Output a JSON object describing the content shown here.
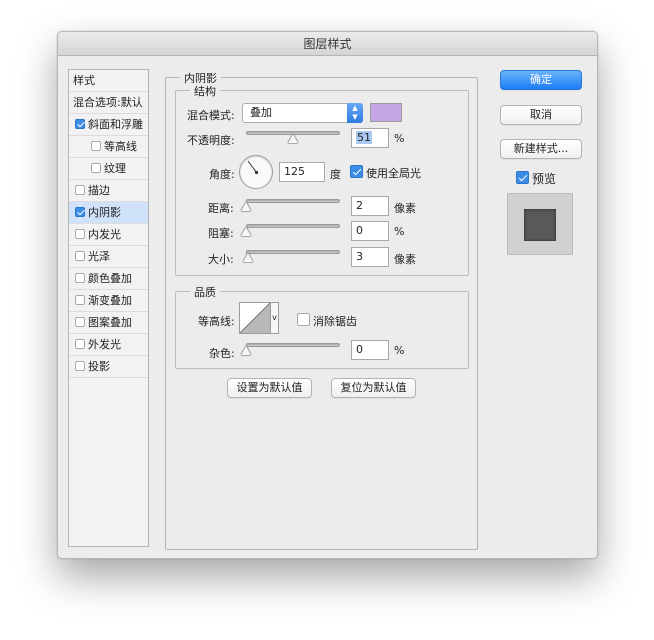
{
  "window": {
    "title": "图层样式"
  },
  "sidebar": {
    "header": "样式",
    "blend_options": "混合选项:默认",
    "items": [
      {
        "label": "斜面和浮雕",
        "checked": true
      },
      {
        "label": "等高线",
        "checked": false
      },
      {
        "label": "纹理",
        "checked": false
      },
      {
        "label": "描边",
        "checked": false
      },
      {
        "label": "内阴影",
        "checked": true,
        "selected": true
      },
      {
        "label": "内发光",
        "checked": false
      },
      {
        "label": "光泽",
        "checked": false
      },
      {
        "label": "颜色叠加",
        "checked": false
      },
      {
        "label": "渐变叠加",
        "checked": false
      },
      {
        "label": "图案叠加",
        "checked": false
      },
      {
        "label": "外发光",
        "checked": false
      },
      {
        "label": "投影",
        "checked": false
      }
    ]
  },
  "panel": {
    "title": "内阴影",
    "structure": {
      "title": "结构",
      "blend_mode_label": "混合模式:",
      "blend_mode_value": "叠加",
      "color": "#c4a6e6",
      "opacity_label": "不透明度:",
      "opacity_value": "51",
      "opacity_unit": "%",
      "angle_label": "角度:",
      "angle_value": "125",
      "angle_unit": "度",
      "global_light_label": "使用全局光",
      "global_light_checked": true,
      "distance_label": "距离:",
      "distance_value": "2",
      "distance_unit": "像素",
      "choke_label": "阻塞:",
      "choke_value": "0",
      "choke_unit": "%",
      "size_label": "大小:",
      "size_value": "3",
      "size_unit": "像素"
    },
    "quality": {
      "title": "品质",
      "contour_label": "等高线:",
      "antialias_label": "消除锯齿",
      "antialias_checked": false,
      "noise_label": "杂色:",
      "noise_value": "0",
      "noise_unit": "%"
    },
    "make_default": "设置为默认值",
    "reset_default": "复位为默认值"
  },
  "actions": {
    "ok": "确定",
    "cancel": "取消",
    "new_style": "新建样式...",
    "preview_label": "预览",
    "preview_checked": true
  },
  "colors": {
    "accent": "#2f7de1",
    "selected_row": "#cfe2f9",
    "shadow_color_swatch": "#c4a6e6",
    "preview_bg": "#d1d1d1",
    "preview_square": "#595959"
  }
}
